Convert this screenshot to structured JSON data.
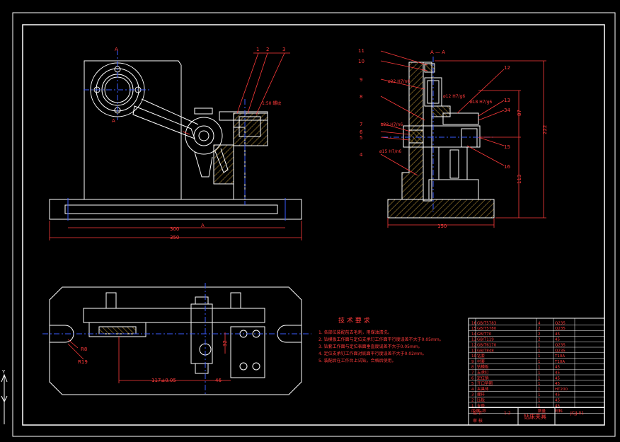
{
  "colors": {
    "background": "#000000",
    "frame": "#ffffff",
    "part": "#ffffff",
    "dimension": "#ff3b3b",
    "hatch": "#c8a040",
    "centerline": "#3a5bff",
    "tech_text": "#ff3b3b",
    "ucs": "#ffffff"
  },
  "front_view": {
    "section_mark_top": "A",
    "section_mark_bottom": "A",
    "section_mark_base": "A",
    "dim_300": "300",
    "dim_350": "350",
    "callout_1": "1",
    "callout_2": "2",
    "callout_3": "3",
    "note": "1:50 螺纹"
  },
  "section_view": {
    "title": "A — A",
    "callouts": [
      "11",
      "10",
      "9",
      "8",
      "7",
      "6",
      "5",
      "4",
      "12",
      "13",
      "34",
      "15",
      "16"
    ],
    "fit_22a": "ø22 H7/n6",
    "fit_12": "ø12 H7/g6",
    "fit_18": "ø18 H7/g6",
    "fit_22b": "ø22 H7/n6",
    "fit_15": "ø15 H7/n6",
    "dim_150": "150",
    "dim_113": "113",
    "dim_87": "87",
    "dim_222": "222"
  },
  "top_view": {
    "r8": "R8",
    "r19": "R19",
    "dim_117": "117±0.05",
    "dim_46": "46",
    "dim_32": "32"
  },
  "tech_requirements": {
    "title": "技 术 要 求",
    "items": [
      "1. 各部位装配前去毛刺，用煤油清洗。",
      "2. 钻模板工作面与定位支承钉工作面平行度误差不大于0.05mm。",
      "3. 钻套工作面与定位表面垂直度误差不大于0.05mm。",
      "4. 定位支承钉工作面对底面平行度误差不大于0.02mm。",
      "5. 装配后在工作台上试钻，合格后使用。"
    ]
  },
  "title_block": {
    "name": "钻床夹具",
    "drawing_no": "JCJJ-01",
    "scale": "1:2",
    "rows": [
      {
        "no": "16",
        "name": "GB/T5783",
        "qty": "4",
        "mat": "Q235"
      },
      {
        "no": "15",
        "name": "GB/T5780",
        "qty": "2",
        "mat": "Q235"
      },
      {
        "no": "14",
        "name": "GB/T70",
        "qty": "2",
        "mat": "45"
      },
      {
        "no": "13",
        "name": "GB/T119",
        "qty": "2",
        "mat": "45"
      },
      {
        "no": "12",
        "name": "GB/T6170",
        "qty": "1",
        "mat": "Q235"
      },
      {
        "no": "11",
        "name": "GB/T848",
        "qty": "1",
        "mat": "Q235"
      },
      {
        "no": "10",
        "name": "钻套",
        "qty": "1",
        "mat": "T10A"
      },
      {
        "no": "9",
        "name": "衬套",
        "qty": "1",
        "mat": "T10A"
      },
      {
        "no": "8",
        "name": "钻模板",
        "qty": "1",
        "mat": "45"
      },
      {
        "no": "7",
        "name": "支承钉",
        "qty": "1",
        "mat": "45"
      },
      {
        "no": "6",
        "name": "定位销",
        "qty": "1",
        "mat": "45"
      },
      {
        "no": "5",
        "name": "开口垫圈",
        "qty": "1",
        "mat": "45"
      },
      {
        "no": "4",
        "name": "夹具体",
        "qty": "1",
        "mat": "HT200"
      },
      {
        "no": "3",
        "name": "螺杆",
        "qty": "1",
        "mat": "45"
      },
      {
        "no": "2",
        "name": "压板",
        "qty": "1",
        "mat": "45"
      },
      {
        "no": "1",
        "name": "支座",
        "qty": "1",
        "mat": "45"
      }
    ],
    "header": {
      "no": "序号",
      "name": "名 称",
      "qty": "数量",
      "mat": "材料"
    },
    "footer_left": "设 计",
    "footer_mid": "审 核"
  },
  "ucs": {
    "y": "Y",
    "x": "X"
  }
}
